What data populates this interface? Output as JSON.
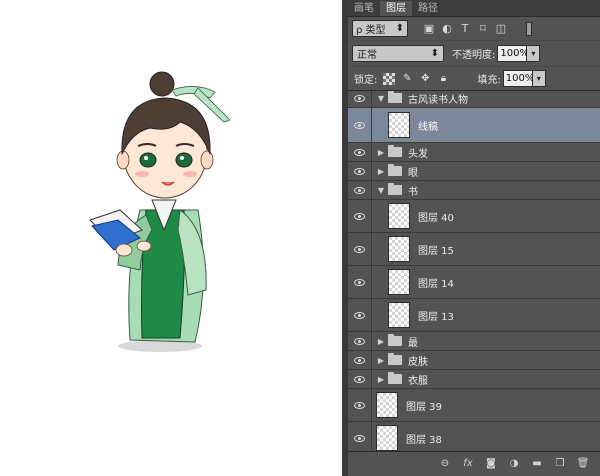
{
  "tabs": [
    {
      "label": "画笔"
    },
    {
      "label": "图层"
    },
    {
      "label": "路径"
    }
  ],
  "filter": {
    "kind_label": "ρ 类型",
    "icons": [
      "image-filter-icon",
      "adjustment-filter-icon",
      "type-filter-icon",
      "shape-filter-icon",
      "smart-object-filter-icon"
    ]
  },
  "blend": {
    "mode": "正常",
    "opacity_label": "不透明度:",
    "opacity_value": "100%"
  },
  "lock": {
    "label": "锁定:",
    "fill_label": "填充:",
    "fill_value": "100%"
  },
  "layers": [
    {
      "name": "古风读书人物",
      "type": "group",
      "expanded": true
    },
    {
      "name": "线稿",
      "type": "layer",
      "selected": true
    },
    {
      "name": "头发",
      "type": "group",
      "expanded": false
    },
    {
      "name": "眼",
      "type": "group",
      "expanded": false
    },
    {
      "name": "书",
      "type": "group",
      "expanded": true
    },
    {
      "name": "图层 40",
      "type": "layer"
    },
    {
      "name": "图层 15",
      "type": "layer"
    },
    {
      "name": "图层 14",
      "type": "layer"
    },
    {
      "name": "图层 13",
      "type": "layer"
    },
    {
      "name": "最",
      "type": "group",
      "expanded": false
    },
    {
      "name": "皮肤",
      "type": "group",
      "expanded": false
    },
    {
      "name": "衣服",
      "type": "group",
      "expanded": false
    },
    {
      "name": "图层 39",
      "type": "layer"
    },
    {
      "name": "图层 38",
      "type": "layer"
    }
  ],
  "colors": {
    "panel_bg": "#535353",
    "selected_row": "#7c8899",
    "robe_green": "#1f8a45",
    "robe_light": "#a7dcb4",
    "book_blue": "#2f6fcf"
  }
}
